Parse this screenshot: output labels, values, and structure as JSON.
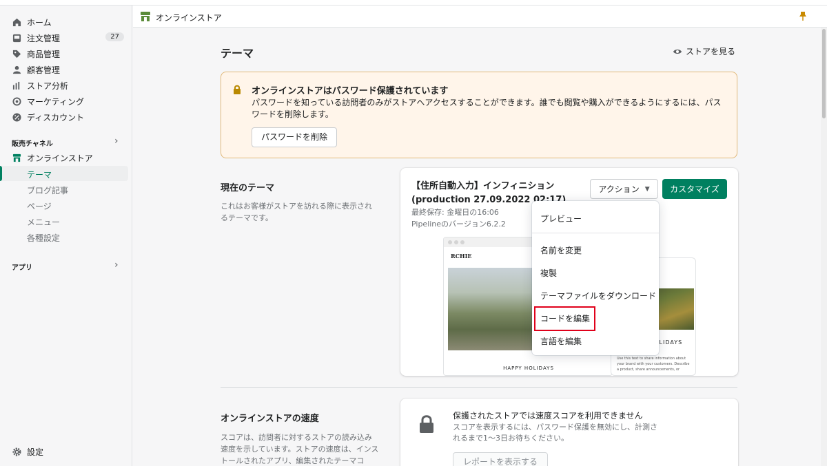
{
  "sidebar": {
    "items": [
      {
        "label": "ホーム"
      },
      {
        "label": "注文管理",
        "badge": "27"
      },
      {
        "label": "商品管理"
      },
      {
        "label": "顧客管理"
      },
      {
        "label": "ストア分析"
      },
      {
        "label": "マーケティング"
      },
      {
        "label": "ディスカウント"
      }
    ],
    "sales_channel_header": "販売チャネル",
    "online_store": "オンラインストア",
    "sub_items": [
      {
        "label": "テーマ",
        "active": true
      },
      {
        "label": "ブログ記事"
      },
      {
        "label": "ページ"
      },
      {
        "label": "メニュー"
      },
      {
        "label": "各種設定"
      }
    ],
    "apps_header": "アプリ",
    "settings": "設定"
  },
  "store_bar": {
    "title": "オンラインストア"
  },
  "main": {
    "title": "テーマ",
    "view_store": "ストアを見る",
    "banner": {
      "title": "オンラインストアはパスワード保護されています",
      "text": "パスワードを知っている訪問者のみがストアへアクセスすることができます。誰でも閲覧や購入ができるようにするには、パスワードを削除します。",
      "button": "パスワードを削除"
    },
    "current_theme": {
      "title": "現在のテーマ",
      "desc": "これはお客様がストアを訪れる際に表示されるテーマです。",
      "name": "【住所自動入力】インフィニション (production 27.09.2022 02:17)",
      "last_saved": "最終保存: 金曜日の16:06",
      "version": "Pipelineのバージョン6.2.2",
      "action_button": "アクション",
      "customize_button": "カスタマイズ",
      "preview_logo": "RCHIE",
      "preview_happy": "HAPPY HOLIDAYS",
      "preview_mobile_text": "Use this text to share information about your brand with your customers. Describe a product, share announcements, or"
    },
    "dropdown": {
      "items": [
        "プレビュー",
        "名前を変更",
        "複製",
        "テーマファイルをダウンロード",
        "コードを編集",
        "言語を編集"
      ]
    },
    "speed": {
      "title": "オンラインストアの速度",
      "desc": "スコアは、訪問者に対するストアの読み込み速度を示しています。ストアの速度は、インストールされたアプリ、編集されたテーマコ",
      "card_title": "保護されたストアでは速度スコアを利用できません",
      "card_text": "スコアを表示するには、パスワード保護を無効にし、計測されるまで1〜3日お待ちください。",
      "card_button": "レポートを表示する"
    }
  },
  "colors": {
    "primary": "#008060",
    "banner_bg": "#fff5ea",
    "highlight": "#e0001a"
  }
}
